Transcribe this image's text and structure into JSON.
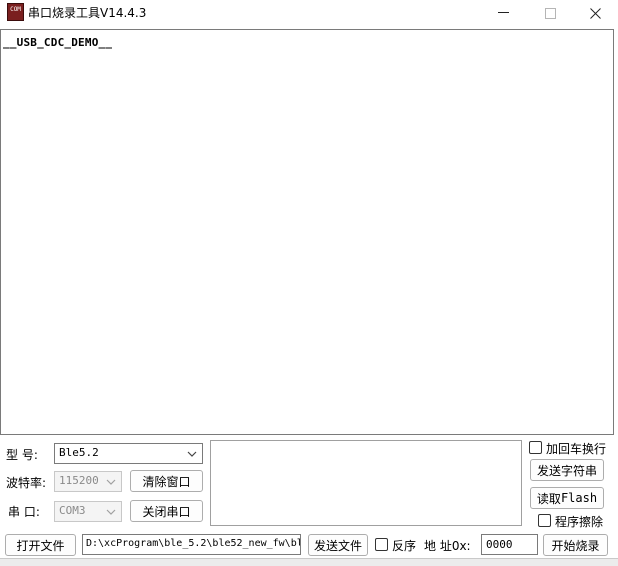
{
  "window": {
    "title": "串口烧录工具V14.4.3",
    "icon_text": "COM",
    "minimize": "—",
    "maximize": "☐",
    "close": "✕"
  },
  "output": {
    "text": "__USB_CDC_DEMO__"
  },
  "controls": {
    "model_label": "型  号:",
    "model_value": "Ble5.2",
    "baud_label": "波特率:",
    "baud_value": "115200",
    "port_label": "串  口:",
    "port_value": "COM3",
    "clear_window": "清除窗口",
    "close_port": "关闭串口",
    "open_file": "打开文件",
    "file_path": "D:\\xcProgram\\ble_5.2\\ble52_new_fw\\bl",
    "send_file": "发送文件",
    "reverse_label": "反序",
    "address_label": "地 址0x:",
    "address_value": "0000",
    "start_burn": "开始烧录",
    "add_crlf_label": "加回车换行",
    "send_string": "发送字符串",
    "read_flash_prefix": "读取",
    "read_flash_suffix": "Flash",
    "erase_program_label": "程序擦除"
  },
  "icons": {
    "dropdown": "chevron-down-icon"
  },
  "colors": {
    "border": "#7a7a7a",
    "app_icon": "#7a1f1f",
    "button_border": "#adadad"
  }
}
